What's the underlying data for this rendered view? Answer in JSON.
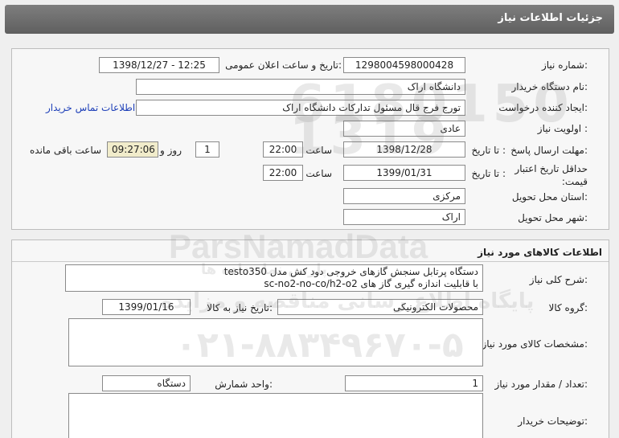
{
  "header": {
    "title": "جزئیات اطلاعات نیاز"
  },
  "need_info": {
    "need_number_label": "شماره نیاز:",
    "need_number": "1298004598000428",
    "announce_label": "تاریخ و ساعت اعلان عمومی:",
    "announce_value": "1398/12/27 - 12:25",
    "buyer_org_label": "نام دستگاه خریدار:",
    "buyer_org": "دانشگاه اراک",
    "requester_label": "ایجاد کننده درخواست:",
    "requester": "تورج فرج قال مسئول تدارکات دانشگاه اراک",
    "contact_link": "اطلاعات تماس خریدار",
    "priority_label": "اولویت نیاز :",
    "priority": "عادی",
    "reply_deadline_label": "مهلت ارسال پاسخ:",
    "to_date_label": "تا تاریخ :",
    "reply_date": "1398/12/28",
    "time_label": "ساعت",
    "reply_time": "22:00",
    "days_value": "1",
    "days_label": "روز و",
    "remaining_time": "09:27:06",
    "remaining_label": "ساعت باقی مانده",
    "validity_label": "حداقل تاریخ اعتبار قیمت:",
    "validity_to_label": "تا تاریخ :",
    "validity_date": "1399/01/31",
    "validity_time_label": "ساعت",
    "validity_time": "22:00",
    "province_label": "استان محل تحویل:",
    "province": "مرکزی",
    "city_label": "شهر محل تحویل:",
    "city": "اراک"
  },
  "goods": {
    "section_title": "اطلاعات کالاهای مورد نیاز",
    "general_desc_label": "شرح کلی نیاز:",
    "general_desc_line1": "دستگاه پرتابل سنجش گازهای خروجی دود کش مدل   testo350",
    "general_desc_line2": "با قابلیت اندازه گیری گاز های sc-no2-no-co/h2-o2",
    "group_label": "گروه کالا:",
    "group": "محصولات الکترونیکی",
    "need_date_label": "تاریخ نیاز به کالا:",
    "need_date": "1399/01/16",
    "specs_label": "مشخصات کالای مورد نیاز:",
    "specs": "",
    "quantity_label": "تعداد / مقدار مورد نیاز:",
    "quantity": "1",
    "unit_label": "واحد شمارش:",
    "unit": "دستگاه",
    "buyer_notes_label": "توضیحات خریدار:",
    "buyer_notes": ""
  },
  "watermarks": {
    "brand": "ParsNamadData",
    "phone": "۰۲۱-۸۸۳۴۹۶۷۰-۵",
    "slogan1": "پایگاه اطلاع رسانی مناقصه و مزایده",
    "slogan2": "پارس نماد داده ها",
    "digits": "6180150 1319"
  }
}
